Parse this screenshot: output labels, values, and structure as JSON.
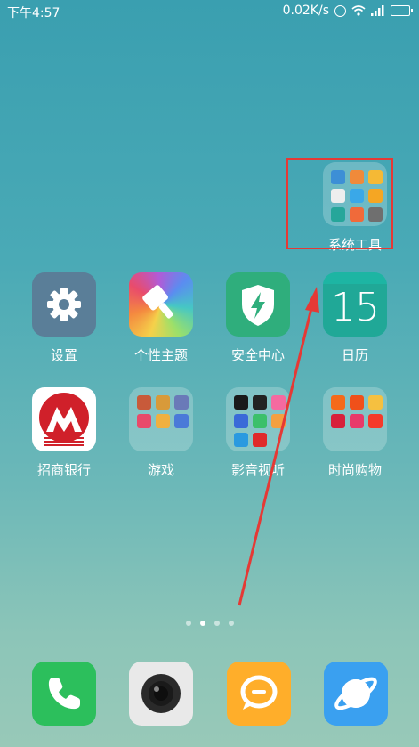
{
  "status_bar": {
    "time": "下午4:57",
    "net_speed": "0.02K/s"
  },
  "home": {
    "folder_system_tools": {
      "label": "系统工具"
    },
    "row1": {
      "settings": "设置",
      "theme": "个性主题",
      "security": "安全中心",
      "calendar": "日历",
      "calendar_day": "15"
    },
    "row2": {
      "bank": "招商银行",
      "games": "游戏",
      "video": "影音视听",
      "shopping": "时尚购物"
    }
  },
  "page_indicator": {
    "count": 4,
    "active_index": 1
  },
  "colors": {
    "annotation_red": "#e53935"
  },
  "dock": [
    "phone-icon",
    "camera-icon",
    "message-icon",
    "browser-icon"
  ]
}
